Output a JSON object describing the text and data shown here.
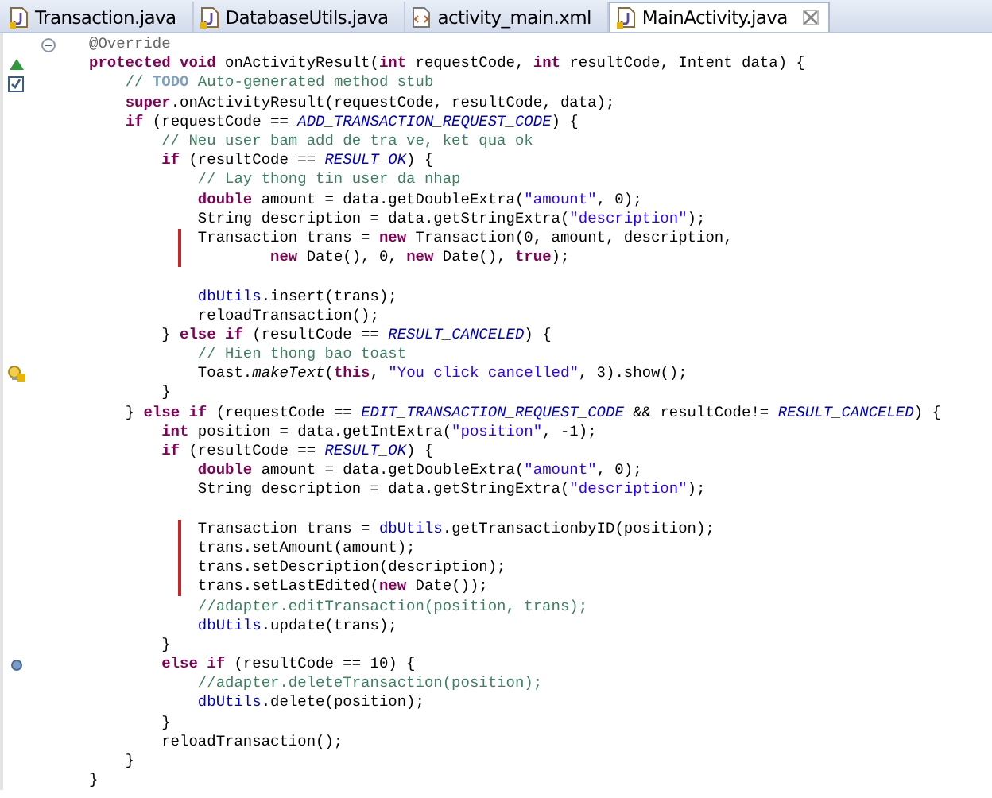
{
  "tabs": [
    {
      "label": "Transaction.java",
      "kind": "java",
      "selected": false
    },
    {
      "label": "DatabaseUtils.java",
      "kind": "java",
      "selected": false
    },
    {
      "label": "activity_main.xml",
      "kind": "xml",
      "selected": false
    },
    {
      "label": "MainActivity.java",
      "kind": "java",
      "selected": true
    }
  ],
  "lines": [
    {
      "fold": true,
      "tokens": [
        {
          "kind": "annotation",
          "text": "@Override"
        }
      ]
    },
    {
      "gutter": {
        "kind": "override"
      },
      "tokens": [
        {
          "kind": "keyword",
          "text": "protected void"
        },
        {
          "kind": "plain",
          "text": " onActivityResult("
        },
        {
          "kind": "keyword",
          "text": "int"
        },
        {
          "kind": "plain",
          "text": " requestCode, "
        },
        {
          "kind": "keyword",
          "text": "int"
        },
        {
          "kind": "plain",
          "text": " resultCode, Intent data) {"
        }
      ]
    },
    {
      "gutter": {
        "kind": "task"
      },
      "tokens": [
        {
          "kind": "comment",
          "text": "    // "
        },
        {
          "kind": "task",
          "text": "TODO"
        },
        {
          "kind": "comment",
          "text": " Auto-generated method stub"
        }
      ]
    },
    {
      "tokens": [
        {
          "kind": "keyword",
          "text": "    super"
        },
        {
          "kind": "plain",
          "text": ".onActivityResult(requestCode, resultCode, data);"
        }
      ]
    },
    {
      "tokens": [
        {
          "kind": "keyword",
          "text": "    if"
        },
        {
          "kind": "plain",
          "text": " (requestCode == "
        },
        {
          "kind": "constant",
          "text": "ADD_TRANSACTION_REQUEST_CODE"
        },
        {
          "kind": "plain",
          "text": ") {"
        }
      ]
    },
    {
      "tokens": [
        {
          "kind": "comment",
          "text": "        // Neu user bam add de tra ve, ket qua ok"
        }
      ]
    },
    {
      "tokens": [
        {
          "kind": "keyword",
          "text": "        if"
        },
        {
          "kind": "plain",
          "text": " (resultCode == "
        },
        {
          "kind": "constant",
          "text": "RESULT_OK"
        },
        {
          "kind": "plain",
          "text": ") {"
        }
      ]
    },
    {
      "tokens": [
        {
          "kind": "comment",
          "text": "            // Lay thong tin user da nhap"
        }
      ]
    },
    {
      "tokens": [
        {
          "kind": "keyword",
          "text": "            double"
        },
        {
          "kind": "plain",
          "text": " amount = data.getDoubleExtra("
        },
        {
          "kind": "string",
          "text": "\"amount\""
        },
        {
          "kind": "plain",
          "text": ", 0);"
        }
      ]
    },
    {
      "tokens": [
        {
          "kind": "plain",
          "text": "            String description = data.getStringExtra("
        },
        {
          "kind": "string",
          "text": "\"description\""
        },
        {
          "kind": "plain",
          "text": ");"
        }
      ]
    },
    {
      "change_bar": true,
      "tokens": [
        {
          "kind": "plain",
          "text": "            Transaction trans = "
        },
        {
          "kind": "keyword",
          "text": "new"
        },
        {
          "kind": "plain",
          "text": " Transaction(0, amount, description,"
        }
      ]
    },
    {
      "change_bar": true,
      "tokens": [
        {
          "kind": "keyword",
          "text": "                    new"
        },
        {
          "kind": "plain",
          "text": " Date(), 0, "
        },
        {
          "kind": "keyword",
          "text": "new"
        },
        {
          "kind": "plain",
          "text": " Date(), "
        },
        {
          "kind": "keyword",
          "text": "true"
        },
        {
          "kind": "plain",
          "text": ");"
        }
      ]
    },
    {
      "blank_line_before": true,
      "tokens": [
        {
          "kind": "field",
          "text": "            dbUtils"
        },
        {
          "kind": "plain",
          "text": ".insert(trans);"
        }
      ]
    },
    {
      "tokens": [
        {
          "kind": "plain",
          "text": "            reloadTransaction();"
        }
      ]
    },
    {
      "tokens": [
        {
          "kind": "plain",
          "text": "        } "
        },
        {
          "kind": "keyword",
          "text": "else if"
        },
        {
          "kind": "plain",
          "text": " (resultCode == "
        },
        {
          "kind": "constant",
          "text": "RESULT_CANCELED"
        },
        {
          "kind": "plain",
          "text": ") {"
        }
      ]
    },
    {
      "tokens": [
        {
          "kind": "comment",
          "text": "            // Hien thong bao toast"
        }
      ]
    },
    {
      "gutter": {
        "kind": "warning"
      },
      "tokens": [
        {
          "kind": "plain",
          "text": "            Toast."
        },
        {
          "kind": "static",
          "text": "makeText"
        },
        {
          "kind": "plain",
          "text": "("
        },
        {
          "kind": "keyword",
          "text": "this"
        },
        {
          "kind": "plain",
          "text": ", "
        },
        {
          "kind": "string",
          "text": "\"You click cancelled\""
        },
        {
          "kind": "plain",
          "text": ", 3).show();"
        }
      ]
    },
    {
      "tokens": [
        {
          "kind": "plain",
          "text": "        }"
        }
      ]
    },
    {
      "tokens": [
        {
          "kind": "plain",
          "text": "    } "
        },
        {
          "kind": "keyword",
          "text": "else if"
        },
        {
          "kind": "plain",
          "text": " (requestCode == "
        },
        {
          "kind": "constant",
          "text": "EDIT_TRANSACTION_REQUEST_CODE"
        },
        {
          "kind": "plain",
          "text": " && resultCode!= "
        },
        {
          "kind": "constant",
          "text": "RESULT_CANCELED"
        },
        {
          "kind": "plain",
          "text": ") {"
        }
      ]
    },
    {
      "tokens": [
        {
          "kind": "keyword",
          "text": "        int"
        },
        {
          "kind": "plain",
          "text": " position = data.getIntExtra("
        },
        {
          "kind": "string",
          "text": "\"position\""
        },
        {
          "kind": "plain",
          "text": ", -1);"
        }
      ]
    },
    {
      "tokens": [
        {
          "kind": "keyword",
          "text": "        if"
        },
        {
          "kind": "plain",
          "text": " (resultCode == "
        },
        {
          "kind": "constant",
          "text": "RESULT_OK"
        },
        {
          "kind": "plain",
          "text": ") {"
        }
      ]
    },
    {
      "tokens": [
        {
          "kind": "keyword",
          "text": "            double"
        },
        {
          "kind": "plain",
          "text": " amount = data.getDoubleExtra("
        },
        {
          "kind": "string",
          "text": "\"amount\""
        },
        {
          "kind": "plain",
          "text": ", 0);"
        }
      ]
    },
    {
      "tokens": [
        {
          "kind": "plain",
          "text": "            String description = data.getStringExtra("
        },
        {
          "kind": "string",
          "text": "\"description\""
        },
        {
          "kind": "plain",
          "text": ");"
        }
      ]
    },
    {
      "blank_line_before": true,
      "change_bar": true,
      "tokens": [
        {
          "kind": "plain",
          "text": "            Transaction trans = "
        },
        {
          "kind": "field",
          "text": "dbUtils"
        },
        {
          "kind": "plain",
          "text": ".getTransactionbyID(position);"
        }
      ]
    },
    {
      "change_bar": true,
      "tokens": [
        {
          "kind": "plain",
          "text": "            trans.setAmount(amount);"
        }
      ]
    },
    {
      "change_bar": true,
      "tokens": [
        {
          "kind": "plain",
          "text": "            trans.setDescription(description);"
        }
      ]
    },
    {
      "change_bar": true,
      "tokens": [
        {
          "kind": "plain",
          "text": "            trans.setLastEdited("
        },
        {
          "kind": "keyword",
          "text": "new"
        },
        {
          "kind": "plain",
          "text": " Date());"
        }
      ]
    },
    {
      "tokens": [
        {
          "kind": "comment",
          "text": "            //adapter.editTransaction(position, trans);"
        }
      ]
    },
    {
      "tokens": [
        {
          "kind": "field",
          "text": "            dbUtils"
        },
        {
          "kind": "plain",
          "text": ".update(trans);"
        }
      ]
    },
    {
      "tokens": [
        {
          "kind": "plain",
          "text": "        }"
        }
      ]
    },
    {
      "gutter": {
        "kind": "dot"
      },
      "tokens": [
        {
          "kind": "keyword",
          "text": "        else if"
        },
        {
          "kind": "plain",
          "text": " (resultCode == 10) {"
        }
      ]
    },
    {
      "tokens": [
        {
          "kind": "comment",
          "text": "            //adapter.deleteTransaction(position);"
        }
      ]
    },
    {
      "tokens": [
        {
          "kind": "field",
          "text": "            dbUtils"
        },
        {
          "kind": "plain",
          "text": ".delete(position);"
        }
      ]
    },
    {
      "tokens": [
        {
          "kind": "plain",
          "text": "        }"
        }
      ]
    },
    {
      "tokens": [
        {
          "kind": "plain",
          "text": "        reloadTransaction();"
        }
      ]
    },
    {
      "tokens": [
        {
          "kind": "plain",
          "text": "    }"
        }
      ]
    },
    {
      "tokens": [
        {
          "kind": "plain",
          "text": "}"
        }
      ]
    }
  ]
}
